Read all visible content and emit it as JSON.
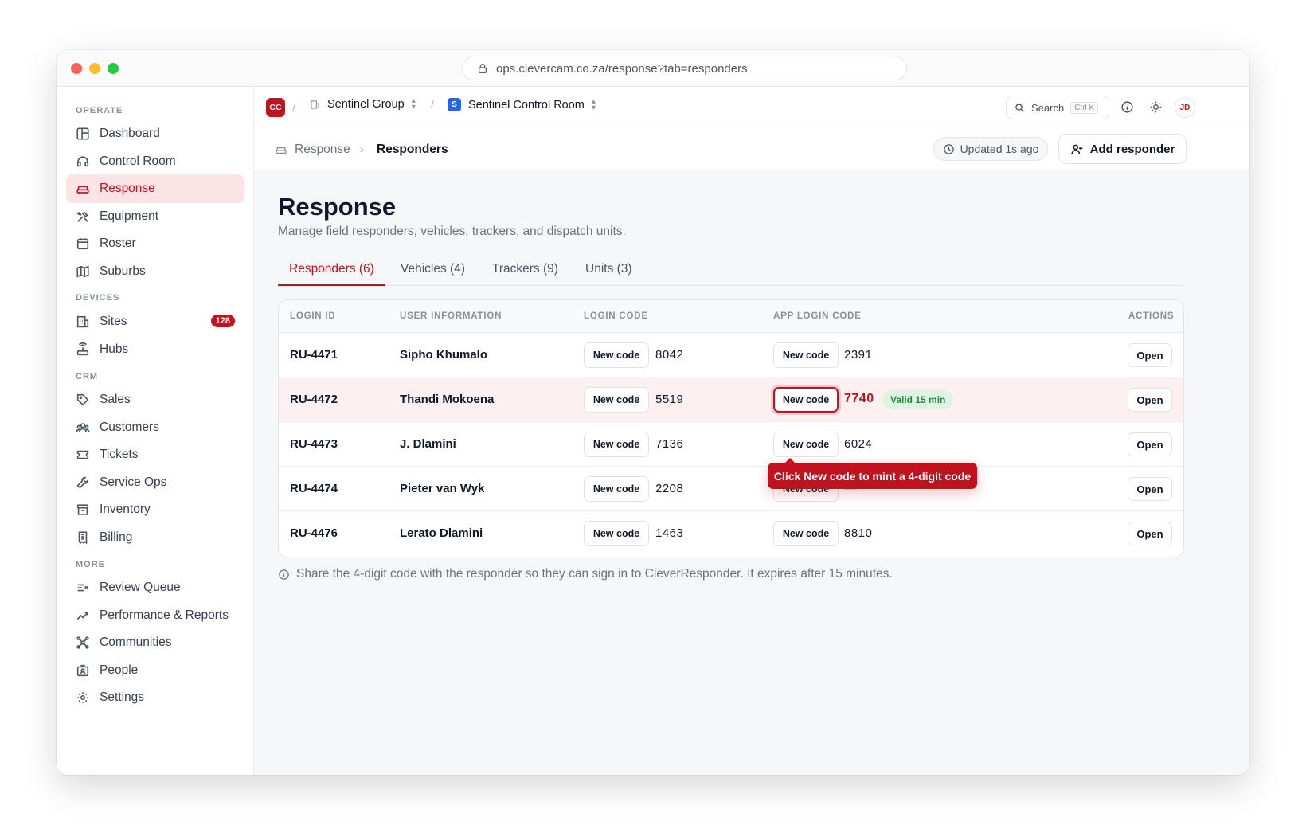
{
  "browser": {
    "url": "ops.clevercam.co.za/response?tab=responders"
  },
  "sidebar": {
    "sections": [
      {
        "label": "OPERATE",
        "items": [
          {
            "label": "Dashboard",
            "icon": "layout-icon"
          },
          {
            "label": "Control Room",
            "icon": "headset-icon"
          },
          {
            "label": "Response",
            "icon": "car-icon",
            "active": true
          },
          {
            "label": "Equipment",
            "icon": "tools-icon"
          },
          {
            "label": "Roster",
            "icon": "calendar-icon"
          },
          {
            "label": "Suburbs",
            "icon": "map-icon"
          }
        ]
      },
      {
        "label": "DEVICES",
        "items": [
          {
            "label": "Sites",
            "icon": "building-icon",
            "badge": "128"
          },
          {
            "label": "Hubs",
            "icon": "router-icon"
          }
        ]
      },
      {
        "label": "CRM",
        "items": [
          {
            "label": "Sales",
            "icon": "tag-icon"
          },
          {
            "label": "Customers",
            "icon": "users-icon"
          },
          {
            "label": "Tickets",
            "icon": "ticket-icon"
          },
          {
            "label": "Service Ops",
            "icon": "wrench-icon"
          },
          {
            "label": "Inventory",
            "icon": "archive-icon"
          },
          {
            "label": "Billing",
            "icon": "receipt-icon"
          }
        ]
      },
      {
        "label": "MORE",
        "items": [
          {
            "label": "Review Queue",
            "icon": "list-check-icon"
          },
          {
            "label": "Performance & Reports",
            "icon": "trend-icon"
          },
          {
            "label": "Communities",
            "icon": "network-icon"
          },
          {
            "label": "People",
            "icon": "id-card-icon"
          },
          {
            "label": "Settings",
            "icon": "gear-icon"
          }
        ]
      }
    ]
  },
  "topbar": {
    "org_badge": "CC",
    "org": "Sentinel Group",
    "room_badge": "S",
    "room": "Sentinel Control Room",
    "search_label": "Search",
    "search_shortcut": "Ctrl K",
    "avatar": "JD"
  },
  "breadcrumb": {
    "parent": "Response",
    "current": "Responders"
  },
  "updated": "Updated 1s ago",
  "add_button": "Add responder",
  "page": {
    "title": "Response",
    "subtitle": "Manage field responders, vehicles, trackers, and dispatch units."
  },
  "tabs": [
    "Responders (6)",
    "Vehicles (4)",
    "Trackers (9)",
    "Units (3)"
  ],
  "table": {
    "headers": [
      "LOGIN ID",
      "USER INFORMATION",
      "LOGIN CODE",
      "APP LOGIN CODE",
      "ACTIONS"
    ],
    "new_code_label": "New code",
    "open_label": "Open",
    "rows": [
      {
        "id": "RU-4471",
        "name": "Sipho Khumalo",
        "login_code": "8042",
        "app_code": "2391"
      },
      {
        "id": "RU-4472",
        "name": "Thandi Mokoena",
        "login_code": "5519",
        "app_code": "7740",
        "validity": "Valid 15 min"
      },
      {
        "id": "RU-4473",
        "name": "J. Dlamini",
        "login_code": "7136",
        "app_code": "6024"
      },
      {
        "id": "RU-4474",
        "name": "Pieter van Wyk",
        "login_code": "2208",
        "app_code": "—"
      },
      {
        "id": "RU-4476",
        "name": "Lerato Dlamini",
        "login_code": "1463",
        "app_code": "8810"
      }
    ]
  },
  "tooltip": "Click New code to mint a 4-digit code",
  "footnote": "Share the 4-digit code with the responder so they can sign in to CleverResponder. It expires after 15 minutes.",
  "colors": {
    "accent": "#c1121f",
    "success": "#1f8f3c",
    "link_blue": "#2563eb"
  }
}
